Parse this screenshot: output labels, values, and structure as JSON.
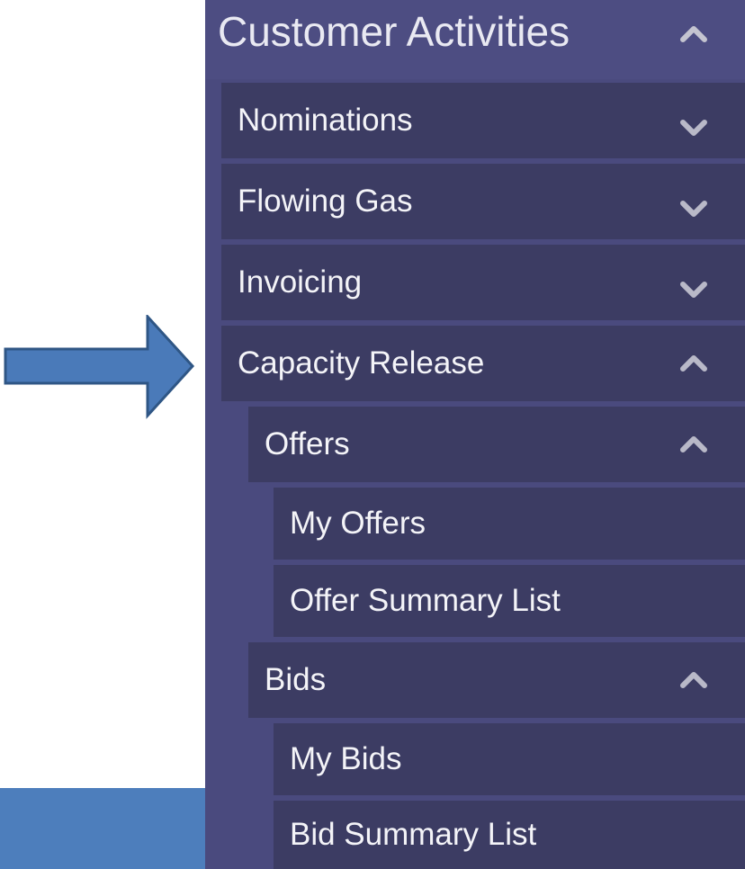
{
  "menu": {
    "title": "Customer Activities",
    "title_icon": "chevron-up-icon",
    "items": [
      {
        "label": "Nominations",
        "icon": "chevron-down-icon"
      },
      {
        "label": "Flowing Gas",
        "icon": "chevron-down-icon"
      },
      {
        "label": "Invoicing",
        "icon": "chevron-down-icon"
      },
      {
        "label": "Capacity Release",
        "icon": "chevron-up-icon"
      }
    ],
    "capacity_release": {
      "groups": [
        {
          "label": "Offers",
          "icon": "chevron-up-icon",
          "children": [
            {
              "label": "My Offers"
            },
            {
              "label": "Offer Summary List"
            }
          ]
        },
        {
          "label": "Bids",
          "icon": "chevron-up-icon",
          "children": [
            {
              "label": "My Bids"
            },
            {
              "label": "Bid Summary List"
            }
          ]
        }
      ]
    }
  },
  "annotation": {
    "arrow_icon": "right-arrow-icon",
    "arrow_color": "#4a7ab9",
    "strip_color": "#4d7ebc"
  },
  "colors": {
    "menu_bg": "#4a4a7e",
    "item_bg": "#3c3c63",
    "text": "#f4f4f8",
    "chevron": "#b9b9c8"
  }
}
